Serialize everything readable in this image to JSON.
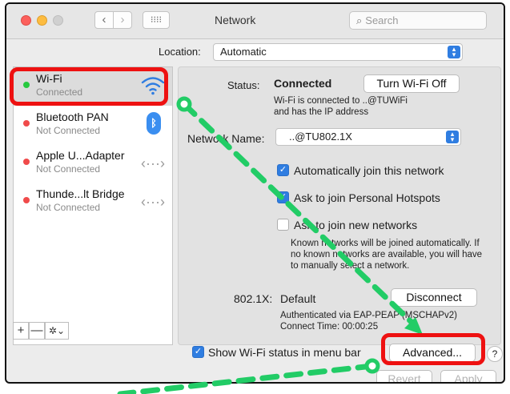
{
  "window": {
    "title": "Network",
    "search_placeholder": "Search",
    "grid_icon": "grid-icon"
  },
  "location": {
    "label": "Location:",
    "value": "Automatic"
  },
  "services": [
    {
      "name": "Wi-Fi",
      "state": "Connected",
      "status_color": "#27c93f",
      "icon": "wifi-icon"
    },
    {
      "name": "Bluetooth PAN",
      "state": "Not Connected",
      "status_color": "#f04a4a",
      "icon": "bluetooth-icon"
    },
    {
      "name": "Apple U...Adapter",
      "state": "Not Connected",
      "status_color": "#f04a4a",
      "icon": "ethernet-icon"
    },
    {
      "name": "Thunde...lt Bridge",
      "state": "Not Connected",
      "status_color": "#f04a4a",
      "icon": "ethernet-icon"
    }
  ],
  "sidebar_tools": {
    "add": "+",
    "remove": "—",
    "gear": "✲⌄"
  },
  "status": {
    "label": "Status:",
    "value": "Connected",
    "turn_off_button": "Turn Wi-Fi Off",
    "description_line1": "Wi-Fi is connected to ..@TUWiFi",
    "description_line2": "and has the IP address"
  },
  "network_name": {
    "label": "Network Name:",
    "value": "..@TU802.1X"
  },
  "options": [
    {
      "label": "Automatically join this network",
      "checked": true
    },
    {
      "label": "Ask to join Personal Hotspots",
      "checked": true
    },
    {
      "label": "Ask to join new networks",
      "checked": false
    }
  ],
  "known_networks_note": {
    "line1": "Known networks will be joined automatically. If",
    "line2": "no known networks are available, you will have",
    "line3": "to manually select a network."
  },
  "dot1x": {
    "label": "802.1X:",
    "value": "Default",
    "disconnect_button": "Disconnect",
    "auth_line": "Authenticated via EAP-PEAP (MSCHAPv2)",
    "connect_time": "Connect Time: 00:00:25"
  },
  "show_status": {
    "label": "Show Wi-Fi status in menu bar",
    "checked": true
  },
  "buttons": {
    "advanced": "Advanced...",
    "help": "?",
    "revert": "Revert",
    "apply": "Apply"
  },
  "colors": {
    "annotation_red": "#ee1111",
    "annotation_green": "#22cc66",
    "accent_blue": "#2f7de1"
  }
}
